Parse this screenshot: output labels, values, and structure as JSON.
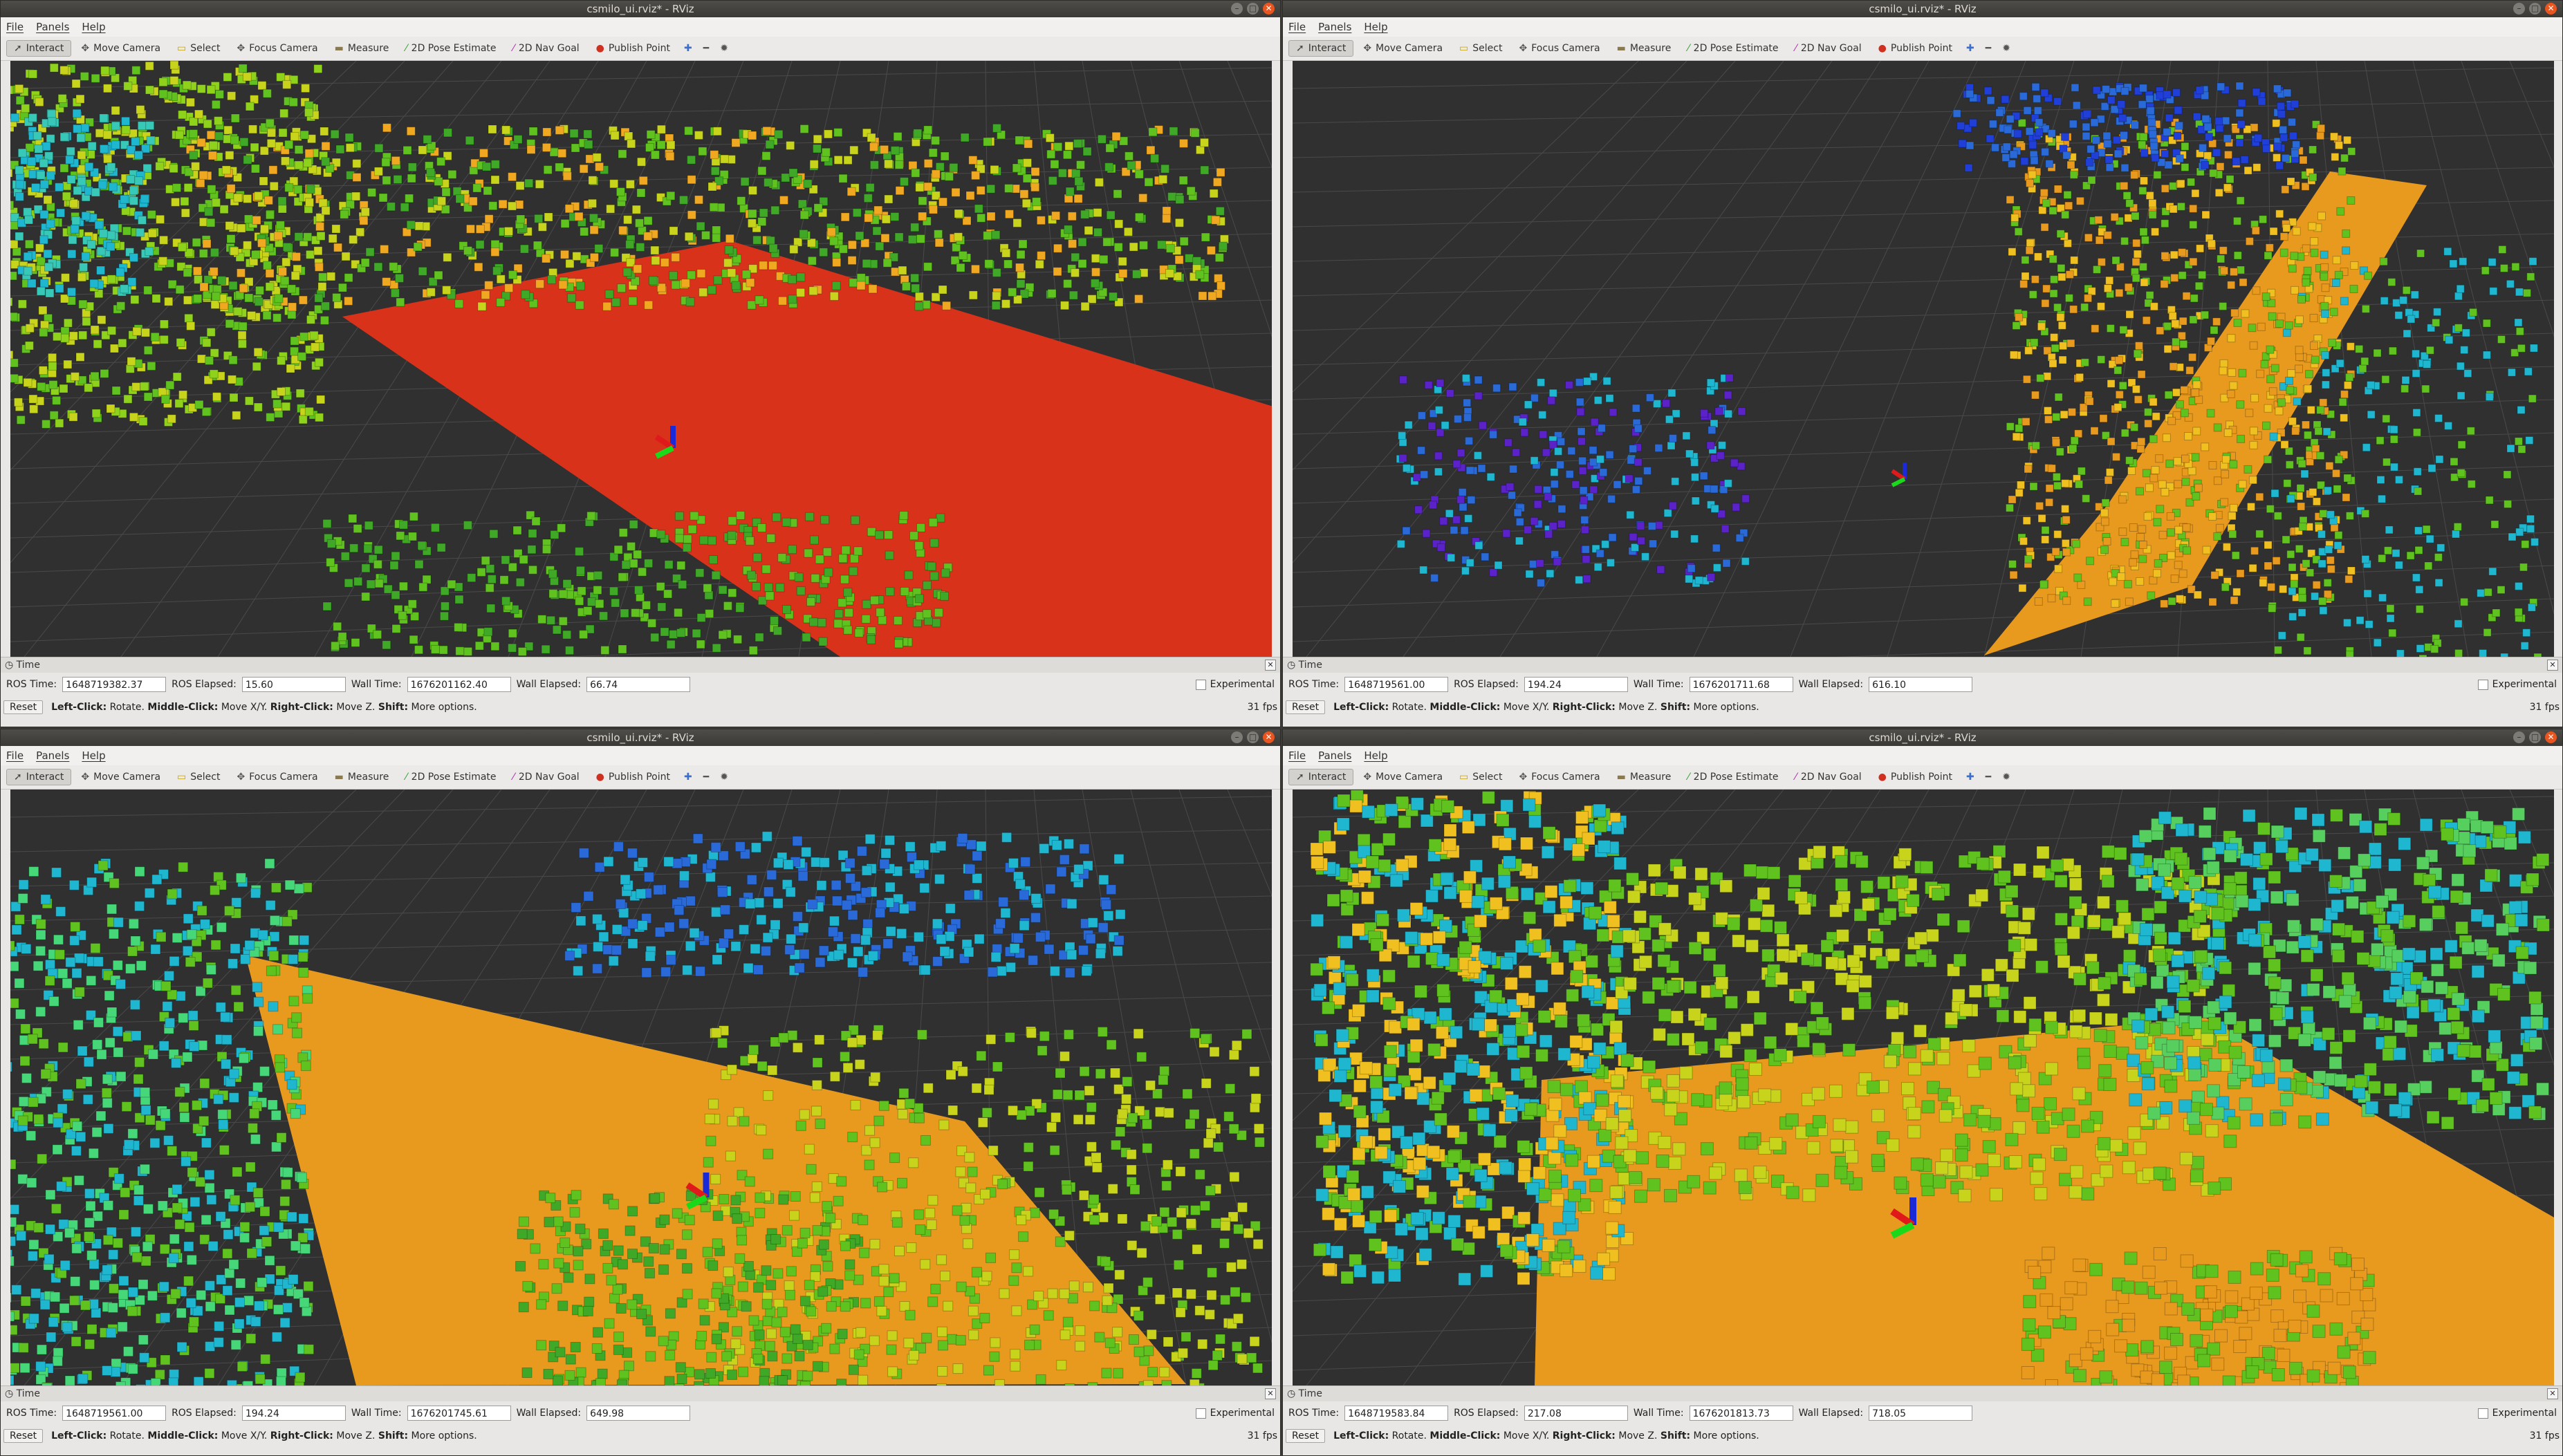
{
  "title": "csmilo_ui.rviz* - RViz",
  "menu": [
    "File",
    "Panels",
    "Help"
  ],
  "tools": [
    {
      "label": "Interact",
      "icon": "interact-icon"
    },
    {
      "label": "Move Camera",
      "icon": "move-camera-icon"
    },
    {
      "label": "Select",
      "icon": "select-icon"
    },
    {
      "label": "Focus Camera",
      "icon": "focus-camera-icon"
    },
    {
      "label": "Measure",
      "icon": "measure-icon"
    },
    {
      "label": "2D Pose Estimate",
      "icon": "pose-estimate-icon"
    },
    {
      "label": "2D Nav Goal",
      "icon": "nav-goal-icon"
    },
    {
      "label": "Publish Point",
      "icon": "publish-point-icon"
    }
  ],
  "time_panel_title": "Time",
  "labels": {
    "ros_time": "ROS Time:",
    "ros_elapsed": "ROS Elapsed:",
    "wall_time": "Wall Time:",
    "wall_elapsed": "Wall Elapsed:",
    "experimental": "Experimental",
    "reset": "Reset"
  },
  "status_hint": {
    "left": "Left-Click:",
    "left_t": "Rotate.",
    "middle": "Middle-Click:",
    "middle_t": "Move X/Y.",
    "right": "Right-Click:",
    "right_t": "Move Z.",
    "shift": "Shift:",
    "shift_t": "More options."
  },
  "windows": [
    {
      "ros_time": "1648719382.37",
      "ros_elapsed": "15.60",
      "wall_time": "1676201162.40",
      "wall_elapsed": "66.74",
      "fps": "31 fps",
      "scene": "red-floor"
    },
    {
      "ros_time": "1648719561.00",
      "ros_elapsed": "194.24",
      "wall_time": "1676201711.68",
      "wall_elapsed": "616.10",
      "fps": "31 fps",
      "scene": "corridor"
    },
    {
      "ros_time": "1648719561.00",
      "ros_elapsed": "194.24",
      "wall_time": "1676201745.61",
      "wall_elapsed": "649.98",
      "fps": "31 fps",
      "scene": "orange-floor"
    },
    {
      "ros_time": "1648719583.84",
      "ros_elapsed": "217.08",
      "wall_time": "1676201813.73",
      "wall_elapsed": "718.05",
      "fps": "31 fps",
      "scene": "orange-close"
    }
  ],
  "colors": {
    "viewport_bg": "#303030",
    "red_voxel": "#d8321a",
    "orange_voxel": "#e89a1e",
    "green_voxel": "#5fc21e",
    "yellow_voxel": "#c8d41c",
    "cyan_voxel": "#1fb6d0",
    "blue_voxel": "#2a6ad8",
    "purple_voxel": "#5a22c8"
  }
}
